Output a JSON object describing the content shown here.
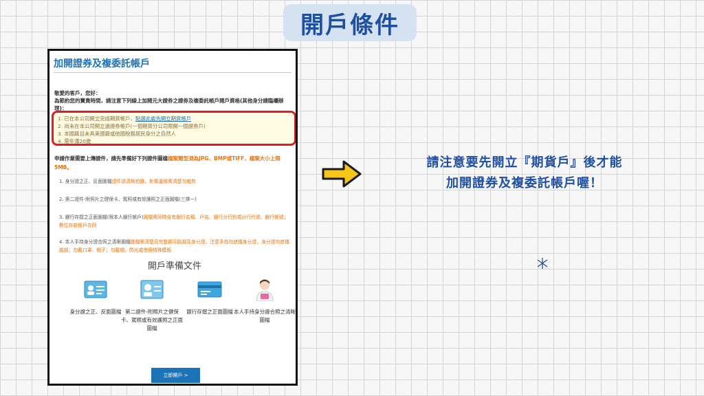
{
  "badge": {
    "title": "開戶條件"
  },
  "panel": {
    "heading": "加開證券及複委託帳戶",
    "greeting": "敬愛的客戶，您好：",
    "intro": "為節約您的寶貴時間，請注意下列線上加開元大證券之證券及複委託帳戶開戶資格(其他身分請臨櫃辦理)：",
    "conditions": [
      {
        "text": "1. 已在本公司開立完成期貨帳戶，",
        "link": "點選此處先開立期貨帳戶"
      },
      {
        "text": "2. 尚未在本公司開立過證券帳戶(一個期貨分公司限開一個證券戶)"
      },
      {
        "text": "3. 本國籍且未具美國籍或他國稅務居民身分之自然人"
      },
      {
        "text": "4. 需年滿20歲"
      }
    ],
    "upload_intro": "申請作業需要上傳證件，請先準備好下列證件圖檔",
    "upload_warning": "檔案類型須為JPG、BMP或TIFF，檔案大小上限5MB。",
    "steps": [
      {
        "text": "1. 身分證之正、反面圖檔",
        "highlight": "證件請清晰拍攝，影像邊緣需清楚勿裁剪"
      },
      {
        "text": "2. 第二證件-附照片之健保卡、駕照或有效護照之正面圖檔(三擇一)",
        "highlight": ""
      },
      {
        "text": "3. 銀行存摺之正面圖檔(限本人銀行帳戶)",
        "highlight": "圖檔需同時含有銀行名稱、戶名、銀行分行別或分行代號、銀行帳號；數位存款帳戶亦同"
      },
      {
        "text": "4. 本人手持身分證合照之清晰圖檔",
        "highlight": "圖檔需清楚且完整顯示臉部及身分證，注意手指勿遮擋身分證，身分證勿遮擋臉部；勿戴口罩、帽子；勿戴帽，閃光或使用特殊模板"
      }
    ],
    "prep_title": "開戶準備文件",
    "docs": [
      {
        "icon": "id-card-icon",
        "label": "身分證之正、反面圖檔"
      },
      {
        "icon": "second-id-icon",
        "label": "第二證件-附照片之健保卡、駕照或有效護照之正面圖檔"
      },
      {
        "icon": "bankbook-icon",
        "label": "銀行存摺之正面圖檔"
      },
      {
        "icon": "selfie-id-icon",
        "label": "本人手持身分證合照之清晰圖檔"
      }
    ],
    "cta": "立即開戶 >"
  },
  "note": {
    "line1": "請注意要先開立『期貨戶』後才能",
    "line2": "加開證券及複委託帳戶喔！"
  },
  "colors": {
    "accent": "#1f4fa0",
    "link": "#1c73b8",
    "highlight_border": "#e01b24",
    "warning": "#e8730c",
    "badge_bg": "#d5e2f2",
    "arrow": "#f5c518"
  }
}
